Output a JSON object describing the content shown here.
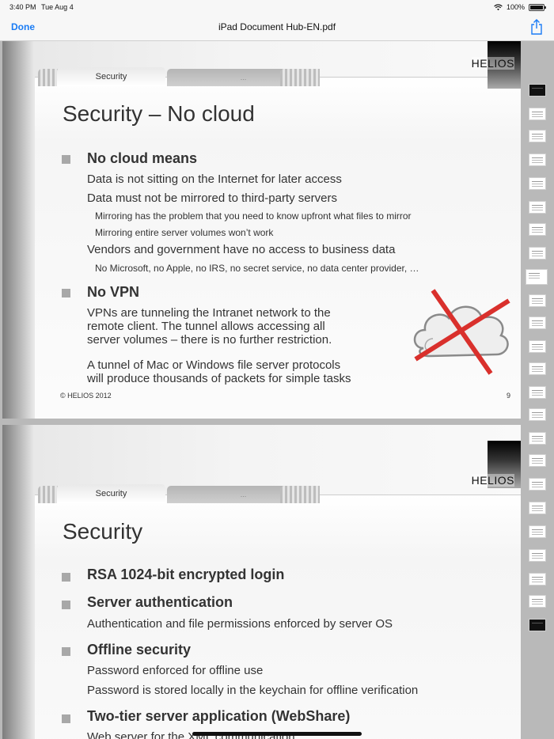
{
  "status": {
    "time": "3:40 PM",
    "date": "Tue Aug 4",
    "battery": "100%"
  },
  "nav": {
    "done": "Done",
    "title": "iPad Document Hub-EN.pdf"
  },
  "page1": {
    "tab_active": "Security",
    "tab_inactive": "...",
    "logo": "HELIOS",
    "heading": "Security – No cloud",
    "b1": "No cloud means",
    "b1_l1": "Data is not sitting on the Internet for later access",
    "b1_l2": "Data must not be mirrored to third-party servers",
    "b1_l2a": "Mirroring has the problem that you need to know upfront what files to mirror",
    "b1_l2b": "Mirroring entire server volumes won’t work",
    "b1_l3": "Vendors and government have no access to business data",
    "b1_l3a": "No Microsoft, no Apple, no IRS, no secret service, no data center provider, …",
    "b2": "No VPN",
    "b2_p1a": "VPNs are tunneling the Intranet network to the",
    "b2_p1b": "remote client. The tunnel allows accessing all",
    "b2_p1c": "server volumes – there is no further restriction.",
    "b2_p2a": "A tunnel of Mac or Windows file server protocols",
    "b2_p2b": "will produce thousands of packets for simple tasks",
    "footer": "© HELIOS 2012",
    "page_number": "9"
  },
  "page2": {
    "tab_active": "Security",
    "tab_inactive": "...",
    "logo": "HELIOS",
    "heading": "Security",
    "b1": "RSA 1024-bit encrypted login",
    "b2": "Server authentication",
    "b2_l1": "Authentication and file permissions enforced by server OS",
    "b3": "Offline security",
    "b3_l1": "Password enforced for offline use",
    "b3_l2": "Password is stored locally in the keychain for offline verification",
    "b4": "Two-tier server application (WebShare)",
    "b4_l1": "Web server for the XML communication"
  },
  "icons": [
    "wifi-icon",
    "battery-icon",
    "share-icon",
    "cloud-icon",
    "cross-icon"
  ],
  "colors": {
    "accent": "#1a7cf5",
    "cross": "#d9302c",
    "bullet": "#a8a8a8"
  }
}
